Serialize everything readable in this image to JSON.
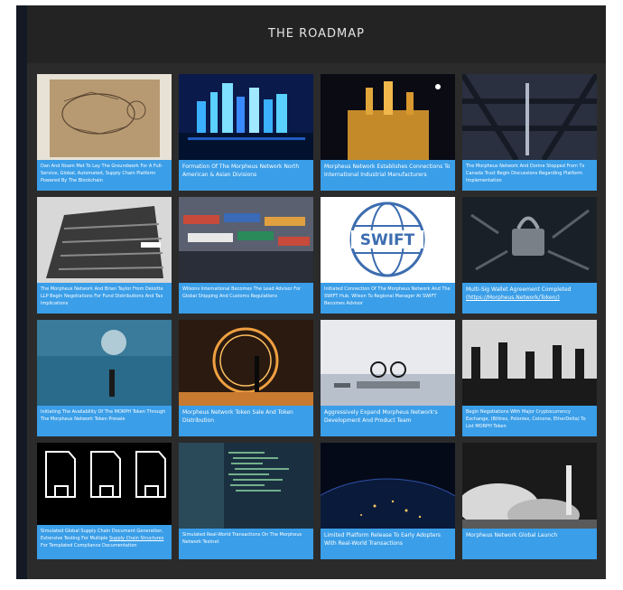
{
  "header": {
    "title": "THE ROADMAP"
  },
  "cards": [
    {
      "caption": "Dan And Noam Met To Lay The Groundwork For A Full-Service, Global, Automated, Supply Chain Platform Powered By The Blockchain"
    },
    {
      "caption": "Formation Of The Morpheus Network North American & Asian Divisions"
    },
    {
      "caption": "Morpheus Network Establishes Connections To International Industrial Manufacturers"
    },
    {
      "caption": "The Morpheus Network And Dorine Stopped From Tx Canada Trust Begin Discussions Regarding Platform Implementation"
    },
    {
      "caption": "The Morpheus Network And Brian Taylor From Deloitte LLP Begin Negotiations For Fund Distributions And Tax Implications"
    },
    {
      "caption": "Wilsons International Becomes The Lead Advisor For Global Shipping And Customs Regulations"
    },
    {
      "caption": "Initiated Connection Of The Morpheus Network And The SWIFT Hub. Wilson Tu Regional Manager At SWIFT Becomes Advisor",
      "swift": "SWIFT"
    },
    {
      "caption": "Multi-Sig Wallet Agreement Completed",
      "link": "(https://Morpheus.Network/Token/)"
    },
    {
      "caption": "Initiating The Availability Of The MORPH Token Through The Morpheus Network Token Presale"
    },
    {
      "caption": "Morpheus Network Token Sale And Token Distribution"
    },
    {
      "caption": "Aggressively Expand Morpheus Network's Development And Product Team"
    },
    {
      "caption": "Begin Negotiations With Major Cryptocurrency Exchange, (Bittrex, Poloniex, Coinone, EtherDelta) To List MORPH Token"
    },
    {
      "caption": "Simulated Global Supply Chain Document Generation. Extensive Testing For Multiple",
      "link": "Supply Chain Structures",
      "caption_after": "For Templated Compliance Documentation"
    },
    {
      "caption": "Simulated Real-World Transactions On The Morpheus Network Testnet"
    },
    {
      "caption": "Limited Platform Release To Early Adopters With Real-World Transactions"
    },
    {
      "caption": "Morpheus Network Global Launch"
    }
  ]
}
